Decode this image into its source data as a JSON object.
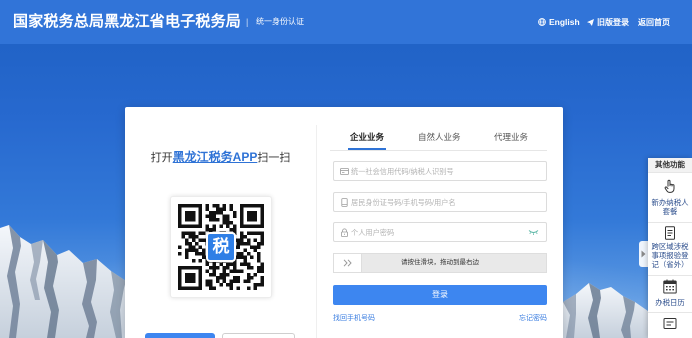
{
  "header": {
    "title": "国家税务总局黑龙江省电子税务局",
    "separator": "|",
    "subtitle": "统一身份认证",
    "links": [
      {
        "label": "English",
        "icon": "globe-icon"
      },
      {
        "label": "旧版登录",
        "icon": "paper-plane-icon"
      },
      {
        "label": "返回首页"
      }
    ]
  },
  "qr_panel": {
    "prefix": "打开",
    "app_name": "黑龙江税务APP",
    "suffix": "扫一扫",
    "qr_logo_text": "税"
  },
  "login": {
    "tabs": [
      {
        "label": "企业业务",
        "active": true
      },
      {
        "label": "自然人业务",
        "active": false
      },
      {
        "label": "代理业务",
        "active": false
      }
    ],
    "fields": {
      "credit_code": {
        "icon": "id-card-icon",
        "placeholder": "统一社会信用代码/纳税人识别号",
        "value": ""
      },
      "account": {
        "icon": "mobile-phone-icon",
        "placeholder": "居民身份证号码/手机号码/用户名",
        "value": ""
      },
      "password": {
        "icon": "lock-icon",
        "placeholder": "个人用户密码",
        "value": "",
        "toggle_icon": "eye-closed-icon"
      }
    },
    "slider": {
      "handle_icon": "double-chevron-right-icon",
      "text": "请按住滑块，拖动到最右边"
    },
    "submit_label": "登录",
    "recover_phone_link": "找回手机号码",
    "forgot_password_link": "忘记密码"
  },
  "side_panel": {
    "title": "其他功能",
    "collapse_icon": "caret-right-icon",
    "items": [
      {
        "icon": "hand-pointer-icon",
        "label": "新办纳税人套餐"
      },
      {
        "icon": "document-icon",
        "label": "跨区域涉税事项报验登记（省外）"
      },
      {
        "icon": "calendar-icon",
        "label": "办税日历"
      },
      {
        "icon": "message-icon"
      }
    ]
  },
  "colors": {
    "header_bg": "#3174d8",
    "primary": "#3d86f0",
    "link": "#2f73d6",
    "sky_top": "#1d5fc2"
  }
}
